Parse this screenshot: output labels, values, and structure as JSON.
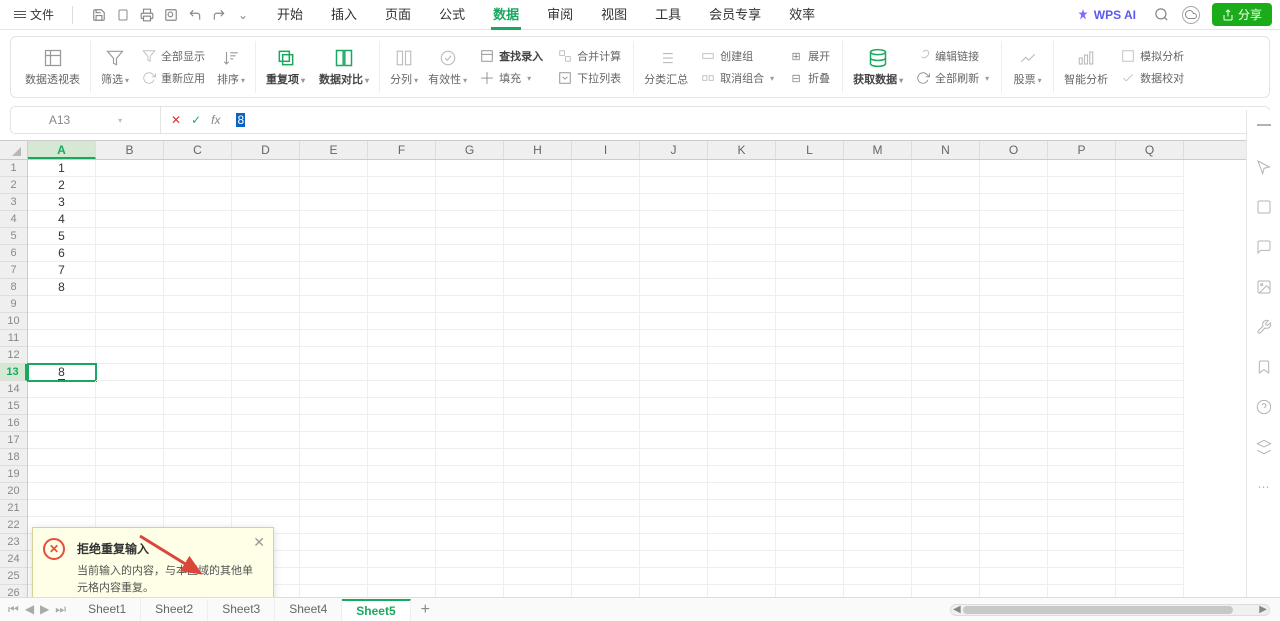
{
  "menubar": {
    "file_label": "文件",
    "tabs": [
      "开始",
      "插入",
      "页面",
      "公式",
      "数据",
      "审阅",
      "视图",
      "工具",
      "会员专享",
      "效率"
    ],
    "active_tab_index": 4,
    "wps_ai": "WPS AI",
    "share": "分享"
  },
  "ribbon": {
    "pivot": "数据透视表",
    "filter": "筛选",
    "show_all": "全部显示",
    "reapply": "重新应用",
    "sort": "排序",
    "dup": "重复项",
    "compare": "数据对比",
    "split": "分列",
    "validity": "有效性",
    "lookup": "查找录入",
    "fill": "填充",
    "merge_calc": "合并计算",
    "dropdown": "下拉列表",
    "subtotal": "分类汇总",
    "group": "创建组",
    "ungroup": "取消组合",
    "expand": "展开",
    "collapse": "折叠",
    "get_data": "获取数据",
    "edit_link": "编辑链接",
    "refresh_all": "全部刷新",
    "stock": "股票",
    "smart_analysis": "智能分析",
    "whatif": "模拟分析",
    "data_check": "数据校对"
  },
  "formula_bar": {
    "cell_ref": "A13",
    "value_sel": "8"
  },
  "grid": {
    "columns": [
      "A",
      "B",
      "C",
      "D",
      "E",
      "F",
      "G",
      "H",
      "I",
      "J",
      "K",
      "L",
      "M",
      "N",
      "O",
      "P",
      "Q"
    ],
    "row_count": 26,
    "selected_col": 0,
    "selected_row": 12,
    "cells_A": [
      "1",
      "2",
      "3",
      "4",
      "5",
      "6",
      "7",
      "8",
      "",
      "",
      "",
      "",
      "8"
    ],
    "active_cell_value": "8"
  },
  "popup": {
    "title": "拒绝重复输入",
    "message": "当前输入的内容，与本区域的其他单元格内容重复。"
  },
  "sheets": {
    "tabs": [
      "Sheet1",
      "Sheet2",
      "Sheet3",
      "Sheet4",
      "Sheet5"
    ],
    "active_index": 4
  }
}
